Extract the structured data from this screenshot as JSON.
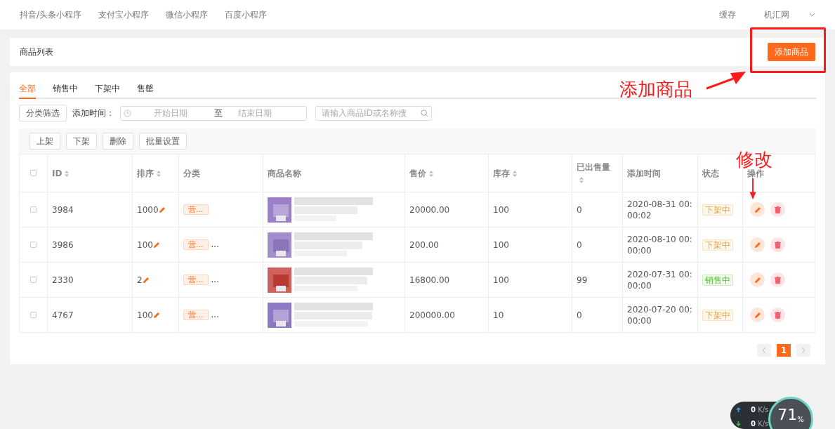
{
  "top_nav": {
    "items": [
      {
        "label": "抖音/头条小程序"
      },
      {
        "label": "支付宝小程序"
      },
      {
        "label": "微信小程序"
      },
      {
        "label": "百度小程序"
      }
    ],
    "cache_link": "缓存",
    "user_menu": "机汇网"
  },
  "page_header": {
    "title": "商品列表",
    "add_button": "添加商品"
  },
  "tabs": [
    {
      "label": "全部",
      "selected": true
    },
    {
      "label": "销售中",
      "selected": false
    },
    {
      "label": "下架中",
      "selected": false
    },
    {
      "label": "售罄",
      "selected": false
    }
  ],
  "filters": {
    "category_button": "分类筛选",
    "date_label": "添加时间：",
    "start_placeholder": "开始日期",
    "separator": "至",
    "end_placeholder": "结束日期",
    "search_placeholder": "请输入商品ID或名称搜"
  },
  "toolbar": [
    "上架",
    "下架",
    "删除",
    "批量设置"
  ],
  "table": {
    "select_all_checked": false,
    "columns": [
      {
        "label": "ID",
        "sortable": true
      },
      {
        "label": "排序",
        "sortable": true
      },
      {
        "label": "分类",
        "sortable": false
      },
      {
        "label": "商品名称",
        "sortable": false
      },
      {
        "label": "售价",
        "sortable": true
      },
      {
        "label": "库存",
        "sortable": true
      },
      {
        "label": "已出售量",
        "sortable": true
      },
      {
        "label": "添加时间",
        "sortable": false
      },
      {
        "label": "状态",
        "sortable": false
      },
      {
        "label": "操作",
        "sortable": false
      }
    ],
    "rows": [
      {
        "checked": false,
        "id": "3984",
        "sort": "1000",
        "category": "营...",
        "more": "",
        "price": "20000.00",
        "stock": "100",
        "sold": "0",
        "added": "2020-08-31 00:00:02",
        "status": {
          "label": "下架中",
          "kind": "off"
        }
      },
      {
        "checked": false,
        "id": "3986",
        "sort": "100",
        "category": "营...",
        "more": "...",
        "price": "200.00",
        "stock": "100",
        "sold": "0",
        "added": "2020-08-10 00:00:00",
        "status": {
          "label": "下架中",
          "kind": "off"
        }
      },
      {
        "checked": false,
        "id": "2330",
        "sort": "2",
        "category": "营...",
        "more": "...",
        "price": "16800.00",
        "stock": "100",
        "sold": "99",
        "added": "2020-07-31 00:00:00",
        "status": {
          "label": "销售中",
          "kind": "on"
        }
      },
      {
        "checked": false,
        "id": "4767",
        "sort": "100",
        "category": "营...",
        "more": "...",
        "price": "200000.00",
        "stock": "10",
        "sold": "0",
        "added": "2020-07-20 00:00:00",
        "status": {
          "label": "下架中",
          "kind": "off"
        }
      }
    ]
  },
  "pagination": {
    "pages": [
      {
        "label": "1",
        "selected": true
      }
    ]
  },
  "annotations": [
    {
      "text": "添加商品",
      "kind": "add"
    },
    {
      "text": "修改",
      "kind": "edit"
    }
  ],
  "net_widget": {
    "up": "0",
    "down": "0",
    "up_unit": "K/s",
    "down_unit": "K/s",
    "percent": "71",
    "percent_sign": "%"
  }
}
